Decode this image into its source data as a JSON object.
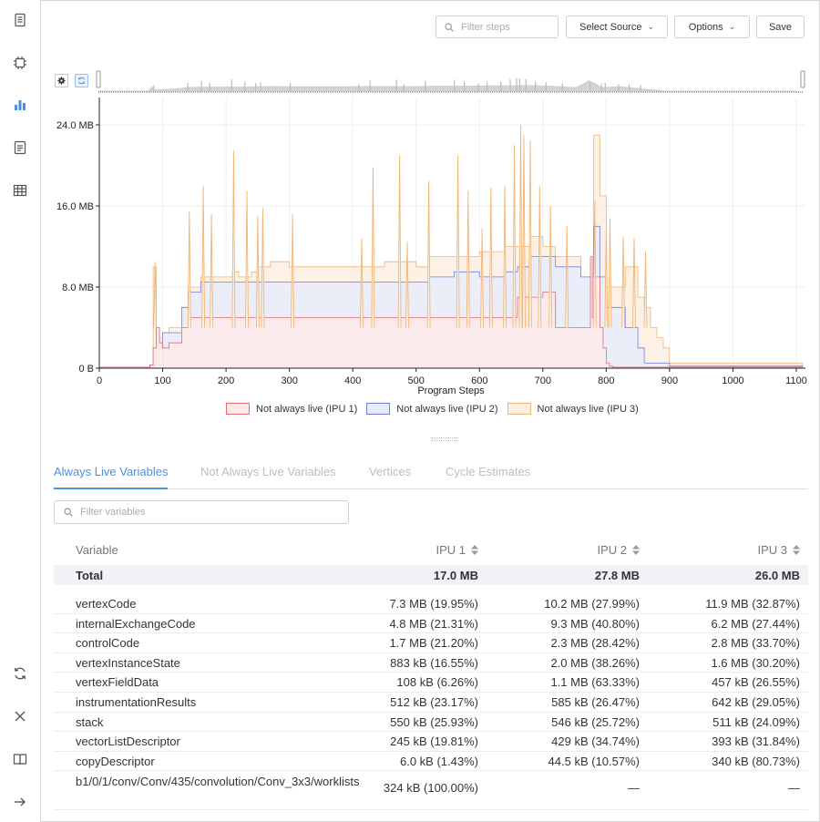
{
  "sidebar": {
    "icons": [
      "document-icon",
      "chip-icon",
      "bar-chart-icon",
      "report-icon",
      "table-icon",
      "refresh-icon",
      "close-icon",
      "book-icon",
      "arrow-right-icon"
    ]
  },
  "toolbar": {
    "filter_placeholder": "Filter steps",
    "source_label": "Select Source",
    "options_label": "Options",
    "save_label": "Save"
  },
  "colors": {
    "ipu1_fill": "#fde9ea",
    "ipu1_line": "#e06b73",
    "ipu2_fill": "#e9ecfb",
    "ipu2_line": "#6f7fe0",
    "ipu3_fill": "#fdf0e2",
    "ipu3_line": "#f0b577",
    "accent": "#4a90e2"
  },
  "chart_data": {
    "type": "area",
    "title": "",
    "xlabel": "Program Steps",
    "ylabel": "",
    "xlim": [
      0,
      1120
    ],
    "ylim": [
      0,
      27
    ],
    "x_ticks": [
      "0",
      "100",
      "200",
      "300",
      "400",
      "500",
      "600",
      "700",
      "800",
      "900",
      "1000",
      "1100"
    ],
    "y_ticks": [
      "0 B",
      "8.0 MB",
      "16.0 MB",
      "24.0 MB"
    ],
    "legend_position": "bottom",
    "series": [
      {
        "name": "Not always live (IPU 1)",
        "x": [
          0,
          80,
          85,
          90,
          95,
          100,
          110,
          130,
          140,
          160,
          200,
          300,
          400,
          500,
          600,
          650,
          660,
          700,
          720,
          760,
          775,
          778,
          782,
          790,
          795,
          800,
          805,
          810,
          900,
          1110
        ],
        "values": [
          0.1,
          0.3,
          2,
          4,
          2.5,
          2,
          2.5,
          4,
          5,
          5,
          5,
          5,
          5,
          5,
          5,
          5,
          7,
          7.5,
          4,
          4,
          11,
          5,
          9,
          4,
          2,
          0.5,
          0.2,
          0.1,
          0.1,
          0.1
        ]
      },
      {
        "name": "Not always live (IPU 2)",
        "x": [
          0,
          80,
          100,
          130,
          140,
          160,
          200,
          300,
          400,
          450,
          520,
          560,
          600,
          640,
          660,
          680,
          720,
          760,
          780,
          790,
          800,
          830,
          850,
          860,
          900,
          1110
        ],
        "values": [
          0.1,
          0.3,
          3.5,
          6,
          7.5,
          8.5,
          8.5,
          8.5,
          8.5,
          8.5,
          9,
          9.5,
          9,
          9.5,
          10,
          11,
          10,
          9,
          14,
          9,
          6,
          4,
          2,
          0.5,
          0.2,
          0.1
        ]
      },
      {
        "name": "Not always live (IPU 3)",
        "x": [
          0,
          80,
          85,
          90,
          95,
          100,
          110,
          130,
          140,
          160,
          170,
          200,
          210,
          220,
          240,
          250,
          260,
          270,
          280,
          300,
          350,
          400,
          450,
          500,
          520,
          560,
          600,
          640,
          660,
          680,
          700,
          720,
          760,
          780,
          790,
          800,
          830,
          850,
          860,
          870,
          880,
          890,
          900,
          1110
        ],
        "values": [
          0.1,
          0.3,
          10,
          2.5,
          3,
          3.5,
          4,
          6,
          8,
          9,
          9,
          9,
          9.5,
          9,
          9.5,
          10,
          10,
          10.5,
          10.5,
          10,
          10,
          10,
          10.5,
          10,
          11,
          11,
          11.5,
          12,
          12,
          13,
          12,
          11,
          8,
          23,
          17,
          8,
          10,
          7,
          6,
          4,
          3,
          2,
          0.5,
          0.1
        ]
      }
    ],
    "spikes": [
      {
        "x": 88,
        "series": 2,
        "peak": 10.5
      },
      {
        "x": 142,
        "series": 2,
        "peak": 15.5
      },
      {
        "x": 164,
        "series": 2,
        "peak": 18.0
      },
      {
        "x": 177,
        "series": 2,
        "peak": 15.2
      },
      {
        "x": 212,
        "series": 2,
        "peak": 21.5
      },
      {
        "x": 233,
        "series": 2,
        "peak": 17.5
      },
      {
        "x": 250,
        "series": 2,
        "peak": 15.0
      },
      {
        "x": 258,
        "series": 2,
        "peak": 15.8
      },
      {
        "x": 305,
        "series": 2,
        "peak": 15.2
      },
      {
        "x": 414,
        "series": 2,
        "peak": 12.8
      },
      {
        "x": 432,
        "series": 2,
        "peak": 19.8
      },
      {
        "x": 474,
        "series": 2,
        "peak": 21.0
      },
      {
        "x": 486,
        "series": 2,
        "peak": 12.5
      },
      {
        "x": 520,
        "series": 2,
        "peak": 18.5
      },
      {
        "x": 566,
        "series": 2,
        "peak": 21.0
      },
      {
        "x": 582,
        "series": 2,
        "peak": 17.5
      },
      {
        "x": 604,
        "series": 2,
        "peak": 13.8
      },
      {
        "x": 618,
        "series": 2,
        "peak": 17.8
      },
      {
        "x": 640,
        "series": 2,
        "peak": 18.0
      },
      {
        "x": 655,
        "series": 2,
        "peak": 22.0
      },
      {
        "x": 665,
        "series": 2,
        "peak": 24.0
      },
      {
        "x": 670,
        "series": 2,
        "peak": 23.0
      },
      {
        "x": 680,
        "series": 2,
        "peak": 22.5
      },
      {
        "x": 695,
        "series": 2,
        "peak": 18.0
      },
      {
        "x": 712,
        "series": 2,
        "peak": 16.0
      },
      {
        "x": 738,
        "series": 2,
        "peak": 14.0
      },
      {
        "x": 782,
        "series": 2,
        "peak": 16.5
      },
      {
        "x": 800,
        "series": 2,
        "peak": 13.5
      },
      {
        "x": 806,
        "series": 2,
        "peak": 14.8
      },
      {
        "x": 827,
        "series": 2,
        "peak": 13.0
      },
      {
        "x": 844,
        "series": 2,
        "peak": 12.8
      },
      {
        "x": 862,
        "series": 2,
        "peak": 11.5
      }
    ]
  },
  "tabs": [
    {
      "label": "Always Live Variables",
      "active": true
    },
    {
      "label": "Not Always Live Variables",
      "active": false
    },
    {
      "label": "Vertices",
      "active": false
    },
    {
      "label": "Cycle Estimates",
      "active": false
    }
  ],
  "table": {
    "filter_placeholder": "Filter variables",
    "headers": [
      "Variable",
      "IPU 1",
      "IPU 2",
      "IPU 3"
    ],
    "total": [
      "Total",
      "17.0 MB",
      "27.8 MB",
      "26.0 MB"
    ],
    "rows": [
      [
        "vertexCode",
        "7.3 MB (19.95%)",
        "10.2 MB (27.99%)",
        "11.9 MB (32.87%)"
      ],
      [
        "internalExchangeCode",
        "4.8 MB (21.31%)",
        "9.3 MB (40.80%)",
        "6.2 MB (27.44%)"
      ],
      [
        "controlCode",
        "1.7 MB (21.20%)",
        "2.3 MB (28.42%)",
        "2.8 MB (33.70%)"
      ],
      [
        "vertexInstanceState",
        "883 kB (16.55%)",
        "2.0 MB (38.26%)",
        "1.6 MB (30.20%)"
      ],
      [
        "vertexFieldData",
        "108 kB (6.26%)",
        "1.1 MB (63.33%)",
        "457 kB (26.55%)"
      ],
      [
        "instrumentationResults",
        "512 kB (23.17%)",
        "585 kB (26.47%)",
        "642 kB (29.05%)"
      ],
      [
        "stack",
        "550 kB (25.93%)",
        "546 kB (25.72%)",
        "511 kB (24.09%)"
      ],
      [
        "vectorListDescriptor",
        "245 kB (19.81%)",
        "429 kB (34.74%)",
        "393 kB (31.84%)"
      ],
      [
        "copyDescriptor",
        "6.0 kB (1.43%)",
        "44.5 kB (10.57%)",
        "340 kB (80.73%)"
      ],
      [
        "b1/0/1/conv/Conv/435/convolution/Conv_3x3/worklists",
        "324 kB (100.00%)",
        "—",
        "—"
      ]
    ]
  }
}
